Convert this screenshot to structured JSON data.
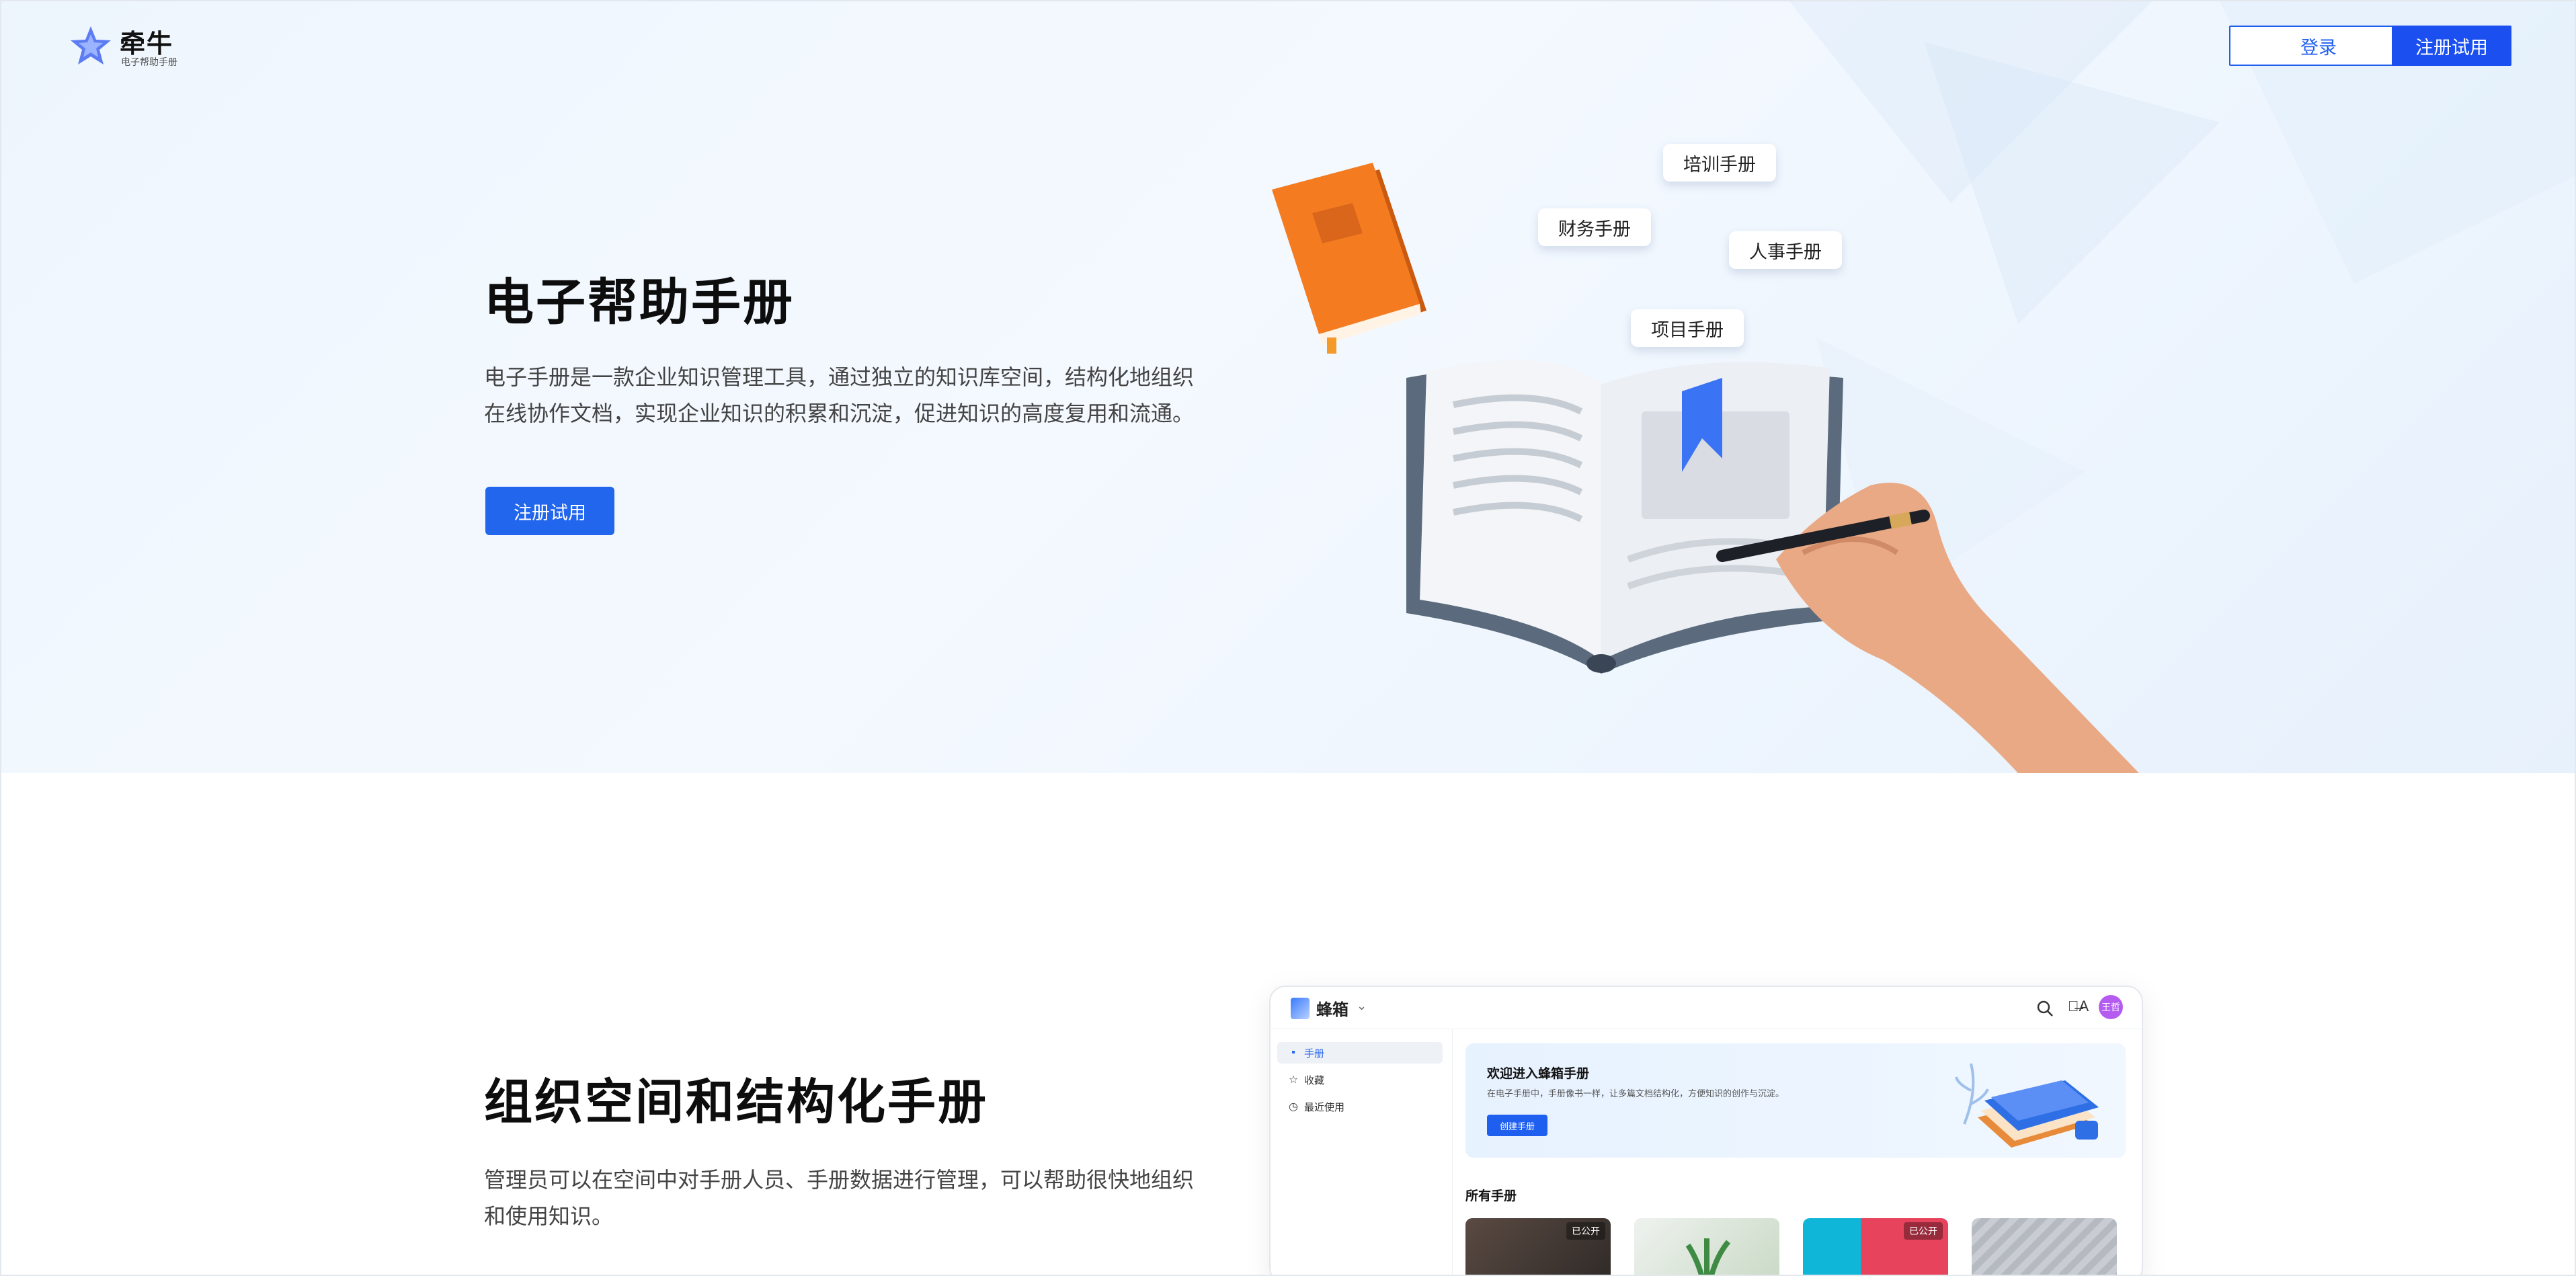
{
  "header": {
    "brand_name": "牵牛",
    "brand_sub": "电子帮助手册",
    "login_label": "登录",
    "register_label": "注册试用"
  },
  "hero": {
    "title": "电子帮助手册",
    "description": "电子手册是一款企业知识管理工具，通过独立的知识库空间，结构化地组织在线协作文档，实现企业知识的积累和沉淀，促进知识的高度复用和流通。",
    "cta_label": "注册试用",
    "tags": [
      "培训手册",
      "财务手册",
      "人事手册",
      "项目手册"
    ]
  },
  "section2": {
    "title": "组织空间和结构化手册",
    "description": "管理员可以在空间中对手册人员、手册数据进行管理，可以帮助很快地组织和使用知识。"
  },
  "mockup": {
    "workspace": "蜂箱",
    "lang_icon": "translate-icon",
    "avatar_text": "王哲",
    "sidebar": [
      {
        "icon": "book-icon",
        "label": "手册"
      },
      {
        "icon": "star-icon",
        "label": "收藏"
      },
      {
        "icon": "clock-icon",
        "label": "最近使用"
      }
    ],
    "banner": {
      "title": "欢迎进入蜂箱手册",
      "subtitle": "在电子手册中，手册像书一样，让多篇文档结构化，方便知识的创作与沉淀。",
      "button": "创建手册"
    },
    "all_title": "所有手册",
    "cards": [
      {
        "badge": "已公开"
      },
      {
        "badge": ""
      },
      {
        "badge": "已公开"
      },
      {
        "badge": ""
      }
    ]
  },
  "colors": {
    "primary": "#1b4ff0",
    "hero_bg": "#eef6fd",
    "book_orange": "#f07a1e"
  }
}
